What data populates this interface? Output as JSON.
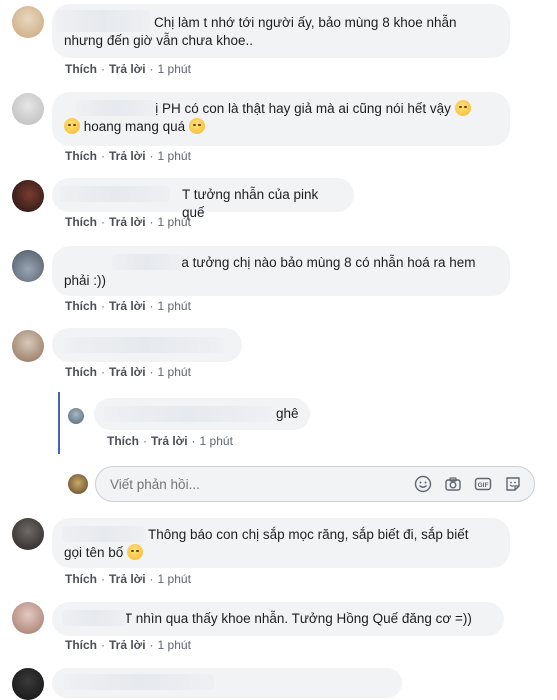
{
  "actions": {
    "like": "Thích",
    "reply": "Trả lời",
    "sep": "·"
  },
  "comments": [
    {
      "line1": "Chị làm t nhớ tới người ấy, bảo mùng 8 khoe nhẫn",
      "line2": "nhưng đến giờ vẫn chưa khoe..",
      "time": "1 phút"
    },
    {
      "line1": "Ủa chị PH có con là thật hay giả mà ai cũng nói hết vậy",
      "line2": "hoang mang quá",
      "time": "1 phút"
    },
    {
      "line1": "T tưởng nhẫn của pink quế",
      "time": "1 phút"
    },
    {
      "line1": "lướt qua tưởng chị nào bảo mùng 8 có nhẫn hoá ra hem",
      "line2": "phải :))",
      "time": "1 phút"
    },
    {
      "line1": "",
      "time": "1 phút"
    },
    {
      "line1": "Thông báo con chị sắp mọc răng, sắp biết đi, sắp biết",
      "line2": "gọi tên bố",
      "time": "1 phút"
    },
    {
      "line1": "T nhìn qua thấy khoe nhẫn. Tưởng Hồng Quế đăng cơ =))",
      "time": "1 phút"
    }
  ],
  "reply": {
    "text": "ghê",
    "time": "1 phút"
  },
  "composer": {
    "placeholder": "Viết phản hồi...",
    "tools": [
      "emoji-icon",
      "camera-icon",
      "gif-icon",
      "sticker-icon"
    ]
  }
}
